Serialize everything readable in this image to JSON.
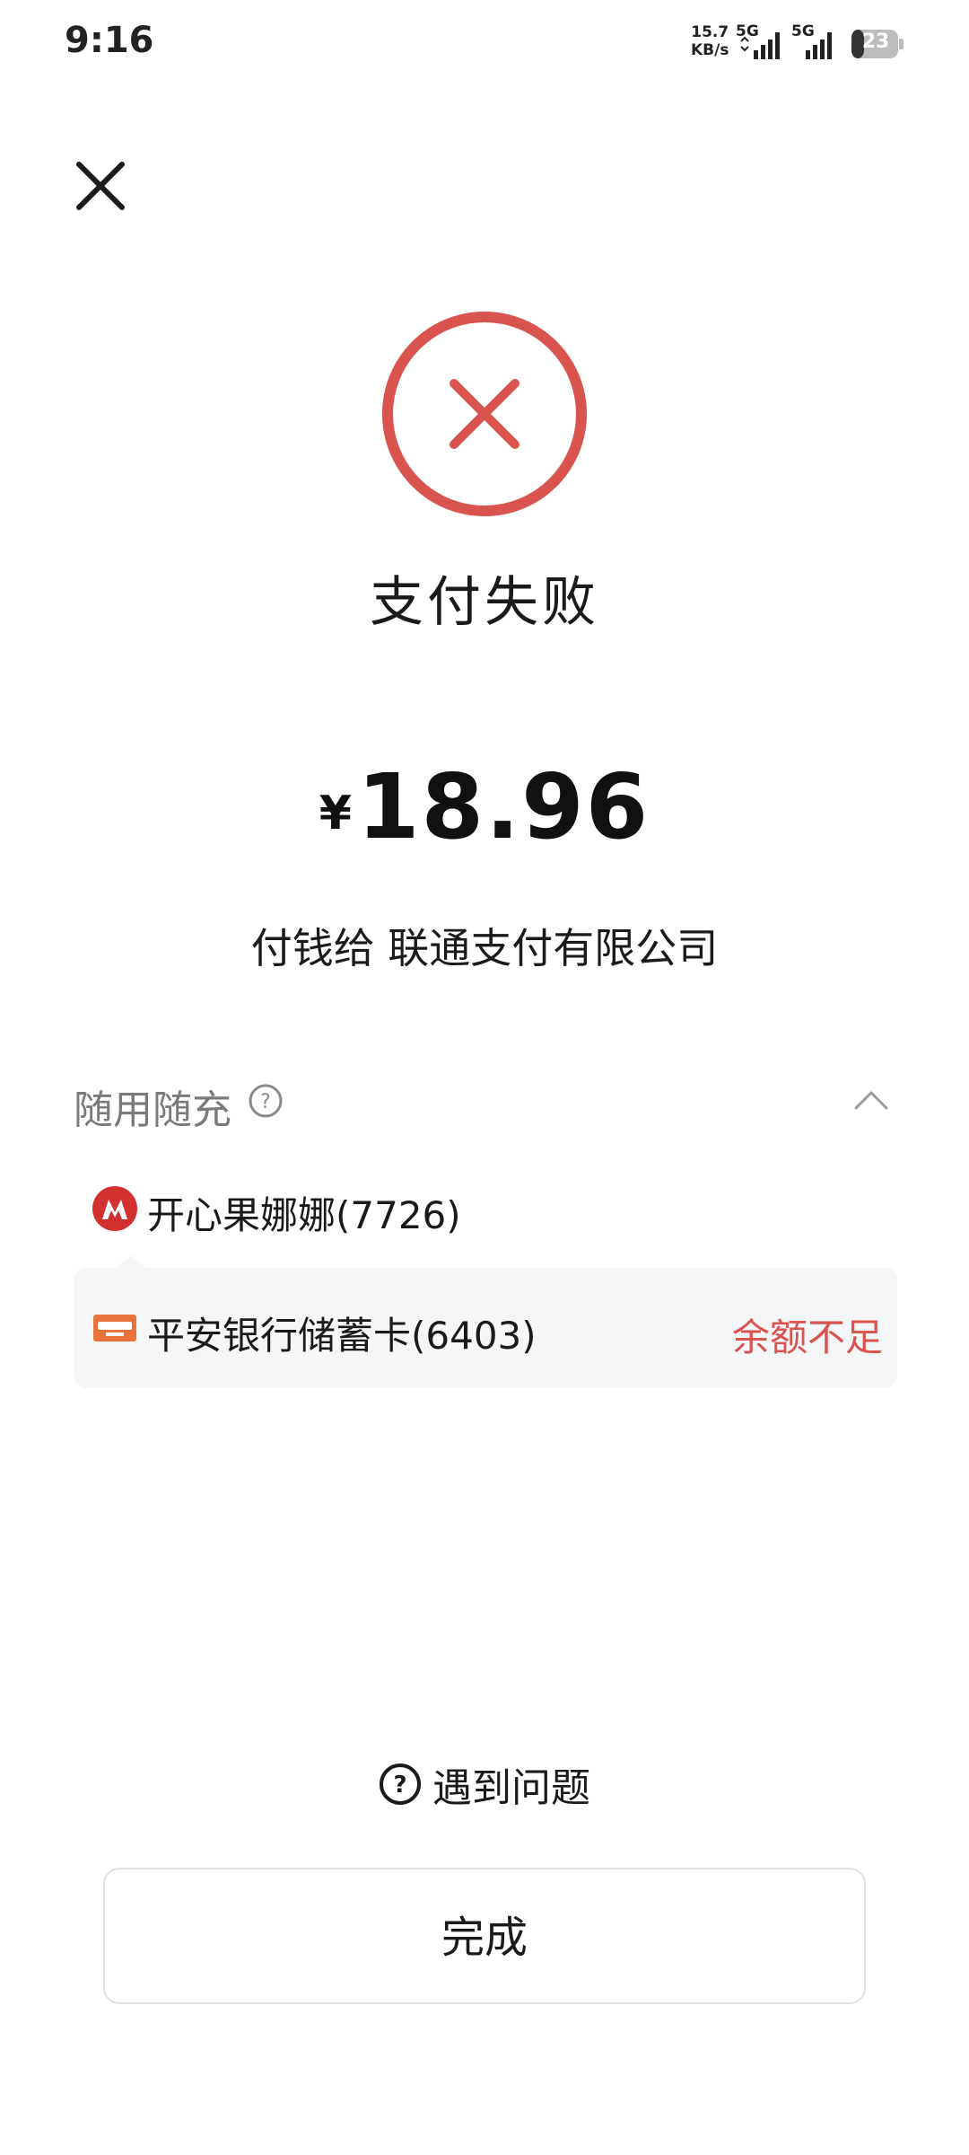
{
  "status_bar": {
    "time": "9:16",
    "net_speed_value": "15.7",
    "net_speed_unit": "KB/s",
    "network_type_1": "5G",
    "network_type_2": "5G",
    "battery": "23"
  },
  "icons": {
    "close": "close-icon",
    "fail": "fail-x-circle-icon",
    "help": "question-circle-icon",
    "collapse": "chevron-up-icon",
    "bank_logo": "cmb-bank-logo",
    "card_logo": "pingan-bank-card-icon"
  },
  "colors": {
    "fail_red": "#d9534f",
    "row_background": "#f5f6f7",
    "muted_text": "#7a7a7a"
  },
  "result": {
    "title": "支付失败",
    "currency": "¥",
    "amount": "18.96",
    "payee": "付钱给 联通支付有限公司"
  },
  "payment_section": {
    "title": "随用随充",
    "methods": [
      {
        "label": "开心果娜娜(7726)",
        "status": ""
      },
      {
        "label": "平安银行储蓄卡(6403)",
        "status": "余额不足"
      }
    ]
  },
  "footer": {
    "problem_label": "遇到问题",
    "done_label": "完成"
  }
}
